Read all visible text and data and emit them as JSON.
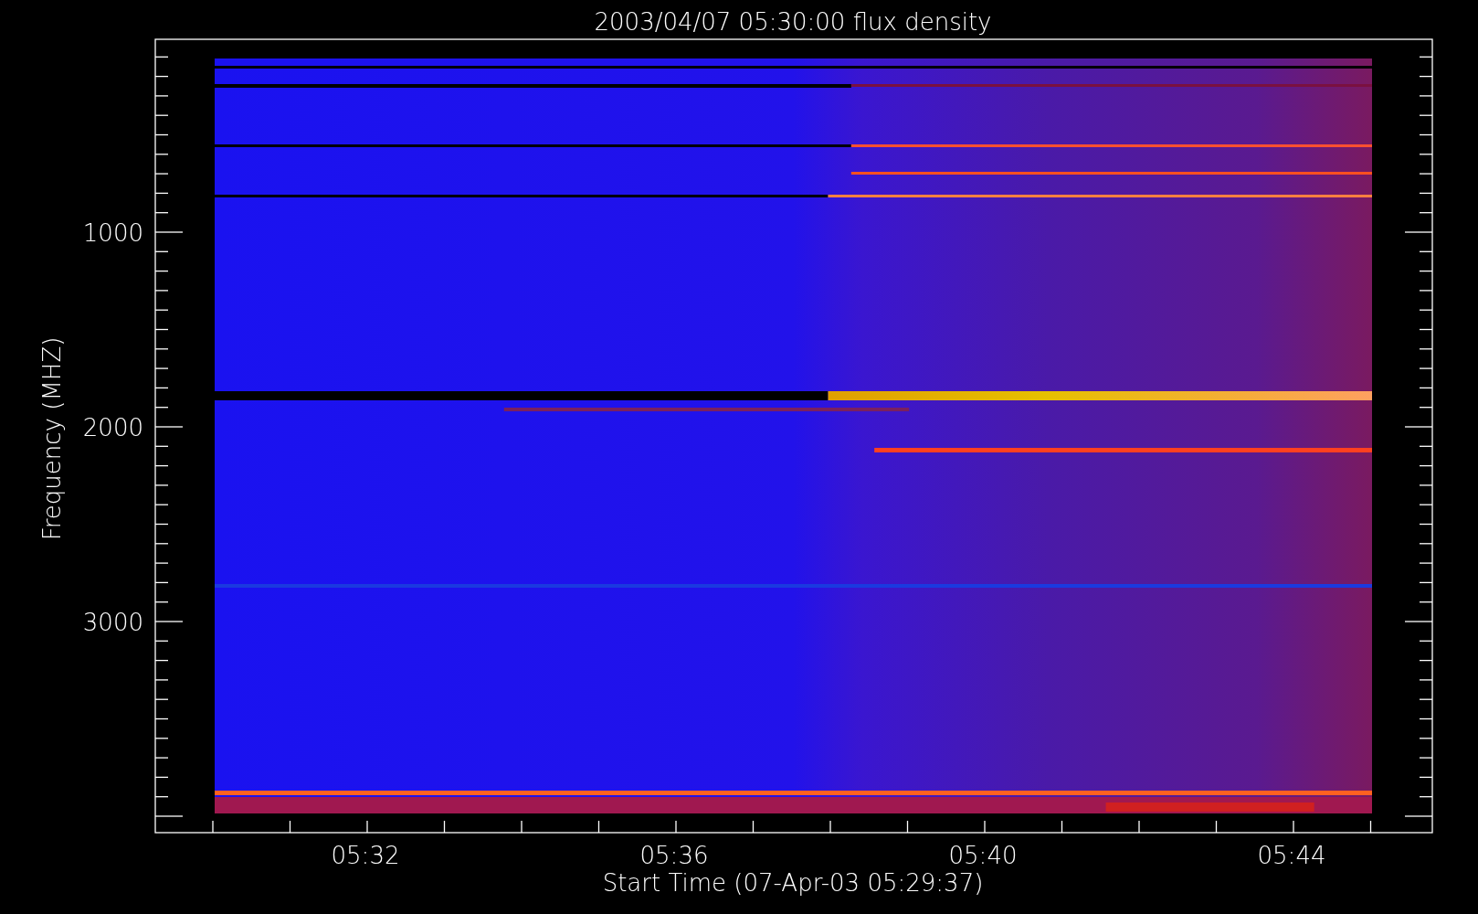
{
  "chart": {
    "title": "2003/04/07 05:30:00 flux density",
    "ylabel": "Frequency (MHZ)",
    "xlabel": "Start Time (07-Apr-03 05:29:37)",
    "y_tick_labels": [
      "1000",
      "2000",
      "3000"
    ],
    "x_tick_labels": [
      "05:32",
      "05:36",
      "05:40",
      "05:44"
    ]
  }
}
